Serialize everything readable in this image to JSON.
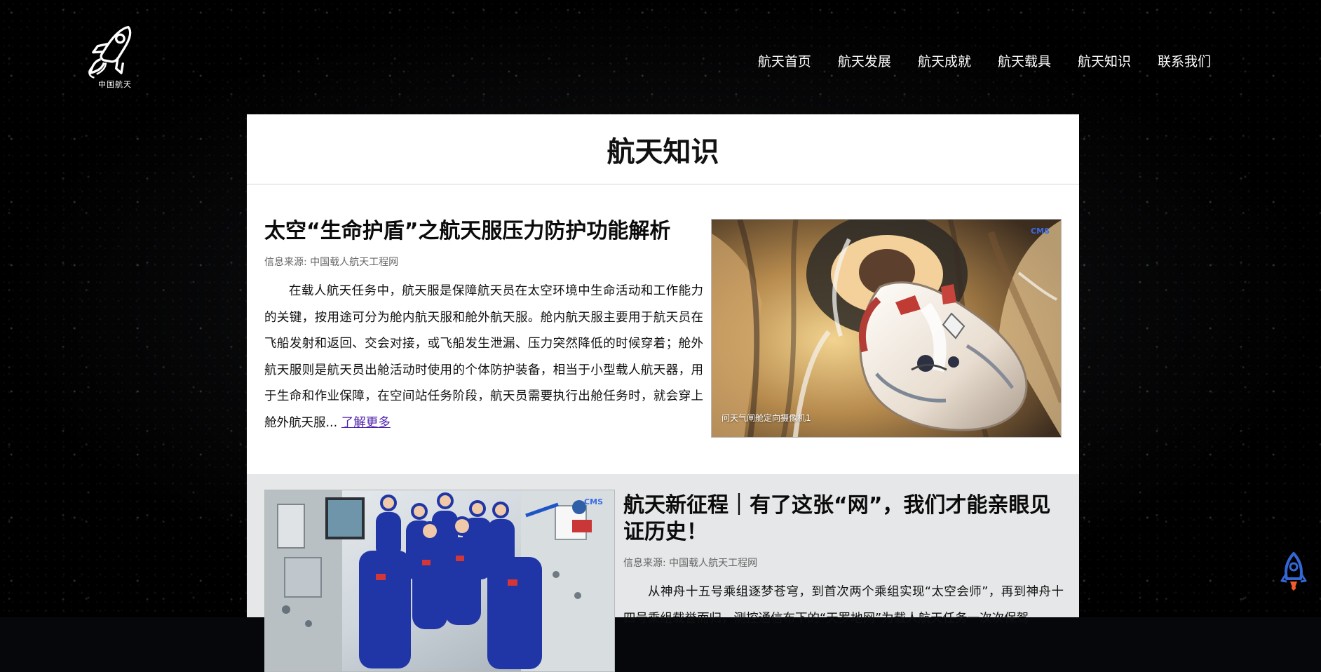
{
  "site": {
    "logo_text": "中国航天",
    "nav": [
      "航天首页",
      "航天发展",
      "航天成就",
      "航天载具",
      "航天知识",
      "联系我们"
    ]
  },
  "page": {
    "title": "航天知识"
  },
  "articles": [
    {
      "title": "太空“生命护盾”之航天服压力防护功能解析",
      "source": "信息来源: 中国载人航天工程网",
      "body": "在载人航天任务中，航天服是保障航天员在太空环境中生命活动和工作能力的关键，按用途可分为舱内航天服和舱外航天服。舱内航天服主要用于航天员在飞船发射和返回、交会对接，或飞船发生泄漏、压力突然降低的时候穿着；舱外航天服则是航天员出舱活动时使用的个体防护装备，相当于小型载人航天器，用于生命和作业保障，在空间站任务阶段，航天员需要执行出舱任务时，就会穿上舱外航天服...",
      "more": "了解更多",
      "image_caption": "问天气闸舱定向摄像机1",
      "image_badge": "CMS"
    },
    {
      "title": "航天新征程｜有了这张“网”，我们才能亲眼见证历史！",
      "source": "信息来源: 中国载人航天工程网",
      "body": "从神舟十五号乘组逐梦苍穹，到首次两个乘组实现“太空会师”，再到神舟十四号乘组载誉而归，测控通信布下的“天罗地网”为载人航天任务一次次保驾",
      "image_badge": "CMS"
    }
  ],
  "colors": {
    "background": "#05070b",
    "content_bg": "#ffffff",
    "alt_section_bg": "#e6e7e8",
    "link": "#4b1fa8",
    "rocket_blue": "#3467d6",
    "rocket_orange": "#f05b2c"
  },
  "icons": {
    "logo": "rocket-logo-icon",
    "float": "rocket-float-icon"
  }
}
